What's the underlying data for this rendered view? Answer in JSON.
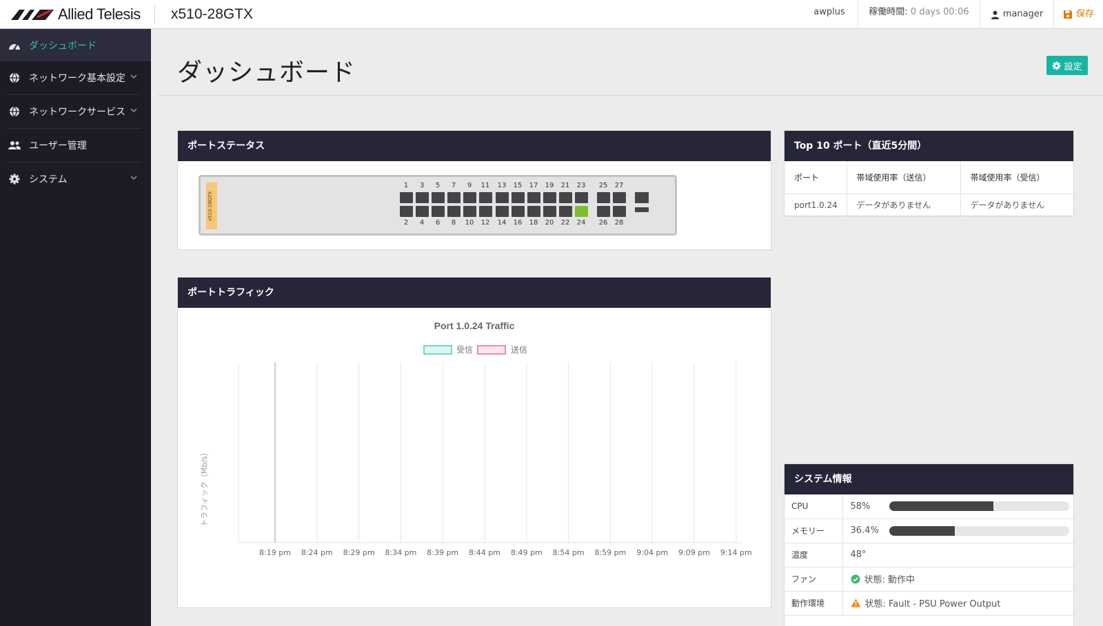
{
  "header": {
    "brand": "Allied Telesis",
    "model": "x510-28GTX",
    "hostname": "awplus",
    "uptime_label": "稼働時間:",
    "uptime_value": "0 days 00:06",
    "user": "manager",
    "save_label": "保存",
    "icons": {
      "user": "user-icon",
      "save": "floppy-disk-icon"
    }
  },
  "sidebar": {
    "items": [
      {
        "label": "ダッシュボード",
        "icon": "dashboard-gauge-icon",
        "active": true
      },
      {
        "label": "ネットワーク基本設定",
        "icon": "globe-icon",
        "expandable": true
      },
      {
        "label": "ネットワークサービス",
        "icon": "globe-icon",
        "expandable": true
      },
      {
        "label": "ユーザー管理",
        "icon": "users-icon"
      },
      {
        "label": "システム",
        "icon": "gear-icon",
        "expandable": true
      }
    ]
  },
  "page": {
    "title": "ダッシュボード",
    "settings_label": "設定"
  },
  "port_status": {
    "title": "ポートステータス",
    "device_tag": "x510-28GTX",
    "top_labels": [
      "1",
      "3",
      "5",
      "7",
      "9",
      "11",
      "13",
      "15",
      "17",
      "19",
      "21",
      "23",
      "25",
      "27"
    ],
    "bottom_labels": [
      "2",
      "4",
      "6",
      "8",
      "10",
      "12",
      "14",
      "16",
      "18",
      "20",
      "22",
      "24",
      "26",
      "28"
    ],
    "link_up_ports": [
      "24"
    ],
    "colors": {
      "port_down": "#444448",
      "port_up": "#7cc02c",
      "tag": "#f5c777"
    }
  },
  "top10": {
    "title": "Top 10 ポート（直近5分間）",
    "columns": [
      "ポート",
      "帯域使用率（送信）",
      "帯域使用率（受信）"
    ],
    "rows": [
      [
        "port1.0.24",
        "データがありません",
        "データがありません"
      ]
    ]
  },
  "traffic": {
    "title": "ポートトラフィック"
  },
  "chart_data": {
    "type": "line",
    "title": "Port 1.0.24 Traffic",
    "xlabel": "",
    "ylabel": "トラフィック（Mb/s）",
    "x": [
      "8:19 pm",
      "8:24 pm",
      "8:29 pm",
      "8:34 pm",
      "8:39 pm",
      "8:44 pm",
      "8:49 pm",
      "8:54 pm",
      "8:59 pm",
      "9:04 pm",
      "9:09 pm",
      "9:14 pm"
    ],
    "series": [
      {
        "name": "受信",
        "values": [],
        "color": "#4cc9b8",
        "fill": "#e0f5f1"
      },
      {
        "name": "送信",
        "values": [],
        "color": "#e36aa0",
        "fill": "#fce6ef"
      }
    ],
    "grid": true,
    "legend": "top"
  },
  "system_info": {
    "title": "システム情報",
    "cpu": {
      "label": "CPU",
      "value_text": "58%",
      "value": 58
    },
    "memory": {
      "label": "メモリー",
      "value_text": "36.4%",
      "value": 36.4
    },
    "temperature": {
      "label": "温度",
      "value": "48°"
    },
    "fan": {
      "label": "ファン",
      "status": "状態: 動作中",
      "icon": "check-circle-icon",
      "color": "#3cb878"
    },
    "environment": {
      "label": "動作環境",
      "status": "状態: Fault - PSU Power Output",
      "icon": "warning-triangle-icon",
      "color": "#ec8a12"
    }
  },
  "colors": {
    "accent": "#17b5a4",
    "sidebar_bg": "#1c1c27",
    "panel_head": "#262638",
    "save": "#e07c00"
  }
}
